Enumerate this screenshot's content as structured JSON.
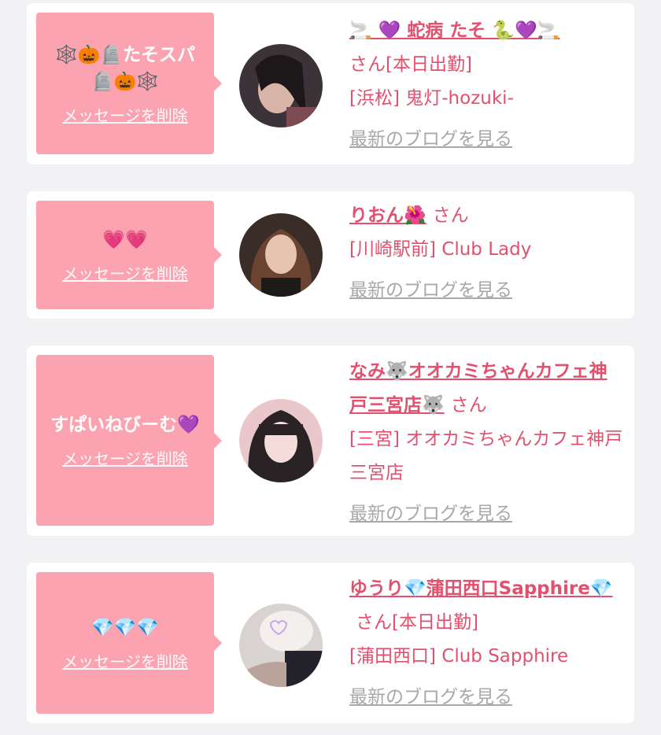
{
  "delete_label": "メッセージを削除",
  "blog_label": "最新のブログを見る",
  "san_label": "さん",
  "cards": [
    {
      "message": "🕸️🎃🪦たそスパ🪦🎃🕸️",
      "name": "🚬 💜 蛇病 たそ 🐍💜🚬",
      "status": "[本日出勤]",
      "shop": "[浜松] 鬼灯-hozuki-"
    },
    {
      "message": "💗💗",
      "name": "りおん🌺",
      "status": "",
      "shop": "[川崎駅前] Club Lady"
    },
    {
      "message": "すぱいねびーむ💜",
      "name": "なみ🐺オオカミちゃんカフェ神戸三宮店🐺",
      "status": "",
      "shop": "[三宮] オオカミちゃんカフェ神戸三宮店"
    },
    {
      "message": "💎💎💎",
      "name": "ゆうり💎蒲田西口Sapphire💎",
      "status": "[本日出勤]",
      "shop": "[蒲田西口] Club Sapphire"
    }
  ],
  "colors": {
    "accent": "#e2506e",
    "bubble": "#fba3b1",
    "link_gray": "#a8a8a8",
    "background": "#f2f2f4"
  }
}
